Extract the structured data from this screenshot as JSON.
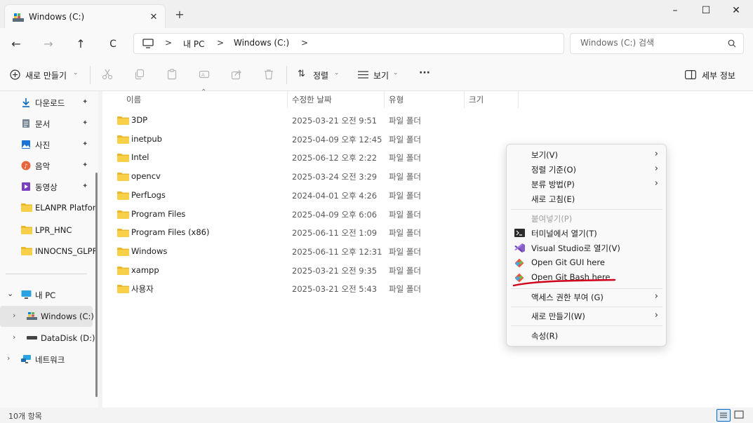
{
  "window": {
    "tab_title": "Windows (C:)",
    "close_tab": "✕",
    "new_tab": "+",
    "minimize": "–",
    "maximize": "☐",
    "close": "✕"
  },
  "nav": {
    "back": "←",
    "forward": "→",
    "up": "↑",
    "refresh": "C",
    "breadcrumb": [
      "내 PC",
      "Windows (C:)"
    ],
    "sep": ">",
    "search_placeholder": "Windows (C:) 검색"
  },
  "toolbar": {
    "new_label": "새로 만들기",
    "sort_label": "정렬",
    "view_label": "보기",
    "more": "···",
    "details_label": "세부 정보"
  },
  "sidebar": {
    "quick": [
      {
        "label": "다운로드",
        "icon": "download-icon",
        "pin": "📌"
      },
      {
        "label": "문서",
        "icon": "document-icon",
        "pin": "📌"
      },
      {
        "label": "사진",
        "icon": "pictures-icon",
        "pin": "📌"
      },
      {
        "label": "음악",
        "icon": "music-icon",
        "pin": "📌"
      },
      {
        "label": "동영상",
        "icon": "video-icon",
        "pin": "📌"
      },
      {
        "label": "ELANPR Platfor",
        "icon": "folder-icon"
      },
      {
        "label": "LPR_HNC",
        "icon": "folder-icon"
      },
      {
        "label": "INNOCNS_GLPF",
        "icon": "folder-icon"
      }
    ],
    "this_pc": "내 PC",
    "drive_c": "Windows (C:)",
    "drive_d": "DataDisk (D:)",
    "network": "네트워크"
  },
  "columns": {
    "name": "이름",
    "date": "수정한 날짜",
    "type": "유형",
    "size": "크기"
  },
  "files": [
    {
      "name": "3DP",
      "date": "2025-03-21 오전 9:51",
      "type": "파일 폴더"
    },
    {
      "name": "inetpub",
      "date": "2025-04-09 오후 12:45",
      "type": "파일 폴더"
    },
    {
      "name": "Intel",
      "date": "2025-06-12 오후 2:22",
      "type": "파일 폴더"
    },
    {
      "name": "opencv",
      "date": "2025-03-24 오전 3:29",
      "type": "파일 폴더"
    },
    {
      "name": "PerfLogs",
      "date": "2024-04-01 오후 4:26",
      "type": "파일 폴더"
    },
    {
      "name": "Program Files",
      "date": "2025-04-09 오후 6:06",
      "type": "파일 폴더"
    },
    {
      "name": "Program Files (x86)",
      "date": "2025-06-11 오전 1:09",
      "type": "파일 폴더"
    },
    {
      "name": "Windows",
      "date": "2025-06-11 오후 12:31",
      "type": "파일 폴더"
    },
    {
      "name": "xampp",
      "date": "2025-03-21 오전 9:35",
      "type": "파일 폴더"
    },
    {
      "name": "사용자",
      "date": "2025-03-21 오전 5:43",
      "type": "파일 폴더"
    }
  ],
  "context_menu": {
    "view": "보기(V)",
    "sort": "정렬 기준(O)",
    "group": "분류 방법(P)",
    "refresh": "새로 고침(E)",
    "paste": "붙여넣기(P)",
    "terminal": "터미널에서 열기(T)",
    "vs": "Visual Studio로 열기(V)",
    "git_gui": "Open Git GUI here",
    "git_bash": "Open Git Bash here",
    "access": "액세스 권한 부여 (G)",
    "new": "새로 만들기(W)",
    "props": "속성(R)",
    "arrow": "›"
  },
  "status": {
    "count": "10개 항목"
  },
  "colors": {
    "folder": "#f4c430",
    "accent": "#0067c0",
    "underline": "#d0021b",
    "vs": "#865fc5",
    "git": "#f05133"
  }
}
